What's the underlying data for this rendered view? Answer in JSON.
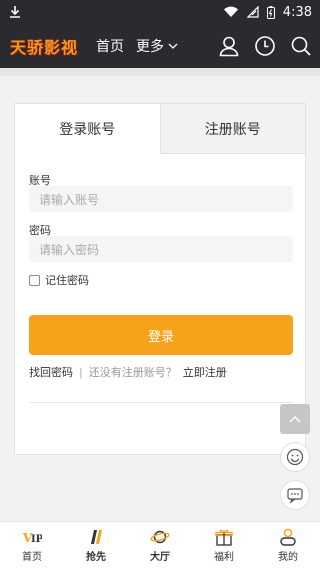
{
  "status_bar": {
    "time": "4:38"
  },
  "nav": {
    "logo_text": "天骄影视",
    "home": "首页",
    "more": "更多"
  },
  "tabs": {
    "login": "登录账号",
    "register": "注册账号"
  },
  "form": {
    "account_label": "账号",
    "account_placeholder": "请输入账号",
    "password_label": "密码",
    "password_placeholder": "请输入密码",
    "remember_label": "记住密码",
    "login_button": "登录",
    "forgot_password": "找回密码",
    "separator": "|",
    "no_account_text": "还没有注册账号？",
    "register_now": "立即注册"
  },
  "tabbar": {
    "items": [
      {
        "label": "首页",
        "icon": "vip-icon"
      },
      {
        "label": "抢先",
        "icon": "film-icon"
      },
      {
        "label": "大厅",
        "icon": "planet-icon"
      },
      {
        "label": "福利",
        "icon": "gift-icon"
      },
      {
        "label": "我的",
        "icon": "user-icon"
      }
    ]
  },
  "colors": {
    "accent": "#f7a21b",
    "nav_bg": "#2a2a2f",
    "logo": "#f39a1e"
  }
}
